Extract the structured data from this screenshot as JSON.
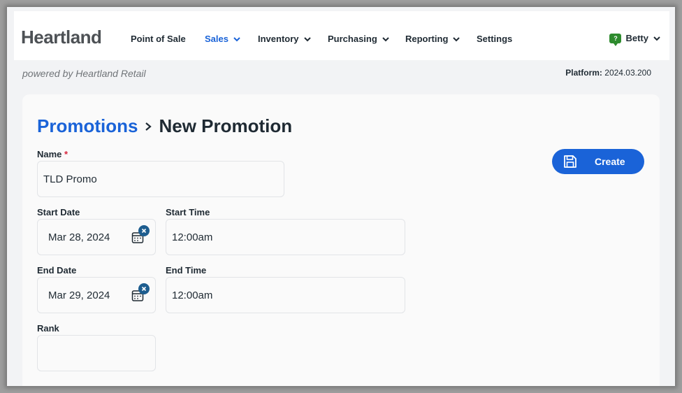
{
  "header": {
    "logo": "Heartland",
    "nav": [
      {
        "label": "Point of Sale",
        "has_dropdown": false,
        "active": false
      },
      {
        "label": "Sales",
        "has_dropdown": true,
        "active": true
      },
      {
        "label": "Inventory",
        "has_dropdown": true,
        "active": false
      },
      {
        "label": "Purchasing",
        "has_dropdown": true,
        "active": false
      },
      {
        "label": "Reporting",
        "has_dropdown": true,
        "active": false
      },
      {
        "label": "Settings",
        "has_dropdown": false,
        "active": false
      }
    ],
    "user": {
      "name": "Betty",
      "help_badge": "?"
    }
  },
  "subheader": {
    "powered_by": "powered by Heartland Retail",
    "platform_label": "Platform:",
    "platform_version": "2024.03.200"
  },
  "breadcrumb": {
    "parent": "Promotions",
    "current": "New Promotion"
  },
  "form": {
    "name_label": "Name",
    "required_marker": "*",
    "name_value": "TLD Promo",
    "start_date_label": "Start Date",
    "start_date_value": "Mar 28, 2024",
    "start_time_label": "Start Time",
    "start_time_value": "12:00am",
    "end_date_label": "End Date",
    "end_date_value": "Mar 29, 2024",
    "end_time_label": "End Time",
    "end_time_value": "12:00am",
    "rank_label": "Rank",
    "rank_value": ""
  },
  "actions": {
    "create_label": "Create"
  },
  "colors": {
    "accent": "#1a63d8",
    "text": "#1f2a33",
    "required": "#d7263d",
    "help_badge": "#2e8b2e",
    "clear_button": "#1d5d8f"
  },
  "icons": {
    "dropdown": "chevron-down-icon",
    "breadcrumb_separator": "chevron-right-icon",
    "calendar": "calendar-icon",
    "clear": "clear-x-icon",
    "save": "floppy-disk-icon",
    "help": "help-chat-icon"
  }
}
